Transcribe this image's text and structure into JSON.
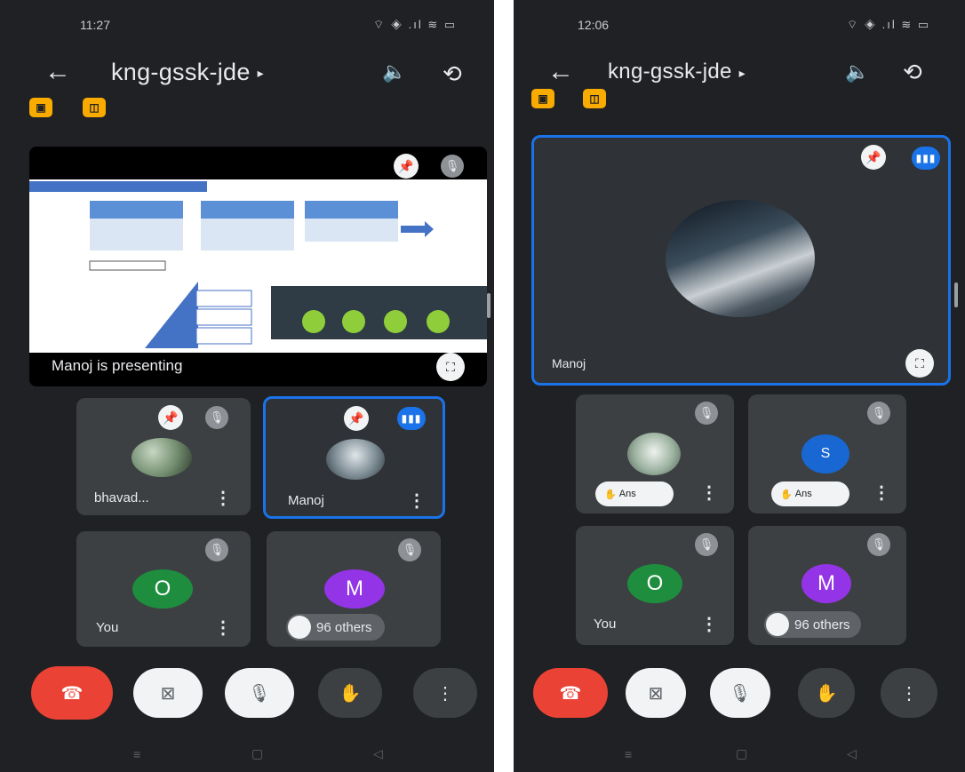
{
  "left": {
    "status_time": "11:27",
    "status_icons": "⌔ ◈ .ıl ≋ ▭",
    "meeting_code": "kng-gssk-jde",
    "presenting_label": "Manoj is presenting",
    "participants": [
      {
        "name": "bhavad...",
        "avatar": "photo"
      },
      {
        "name": "Manoj",
        "avatar": "photo"
      },
      {
        "name": "You",
        "initial": "O",
        "color": "#1e8e3e"
      },
      {
        "name": "96 others",
        "initial": "M",
        "color": "#9334e6"
      }
    ]
  },
  "right": {
    "status_time": "12:06",
    "status_icons": "⌔ ◈ .ıl ≋ ▭",
    "meeting_code": "kng-gssk-jde",
    "main_name": "Manoj",
    "participants": [
      {
        "name": "",
        "avatar": "photo",
        "pill": "Ans"
      },
      {
        "name": "",
        "initial": "S",
        "color": "#1967d2",
        "pill": "Ans"
      },
      {
        "name": "You",
        "initial": "O",
        "color": "#1e8e3e"
      },
      {
        "name": "96 others",
        "initial": "M",
        "color": "#9334e6"
      }
    ]
  },
  "icons": {
    "back": "←",
    "caret": "▸",
    "speaker": "🔈",
    "camera_switch": "⟲",
    "pin": "📌",
    "mic_off": "🎙",
    "kebab": "⋮",
    "end_call": "☎",
    "cam_off": "⊠",
    "hand": "✋",
    "expand": "⛶",
    "nav_menu": "≡",
    "nav_home": "▢",
    "nav_back": "◁"
  },
  "colors": {
    "background": "#202124",
    "tile": "#3c4043",
    "accent": "#1a73e8",
    "end_call": "#ea4335",
    "badge": "#f9ab00"
  }
}
